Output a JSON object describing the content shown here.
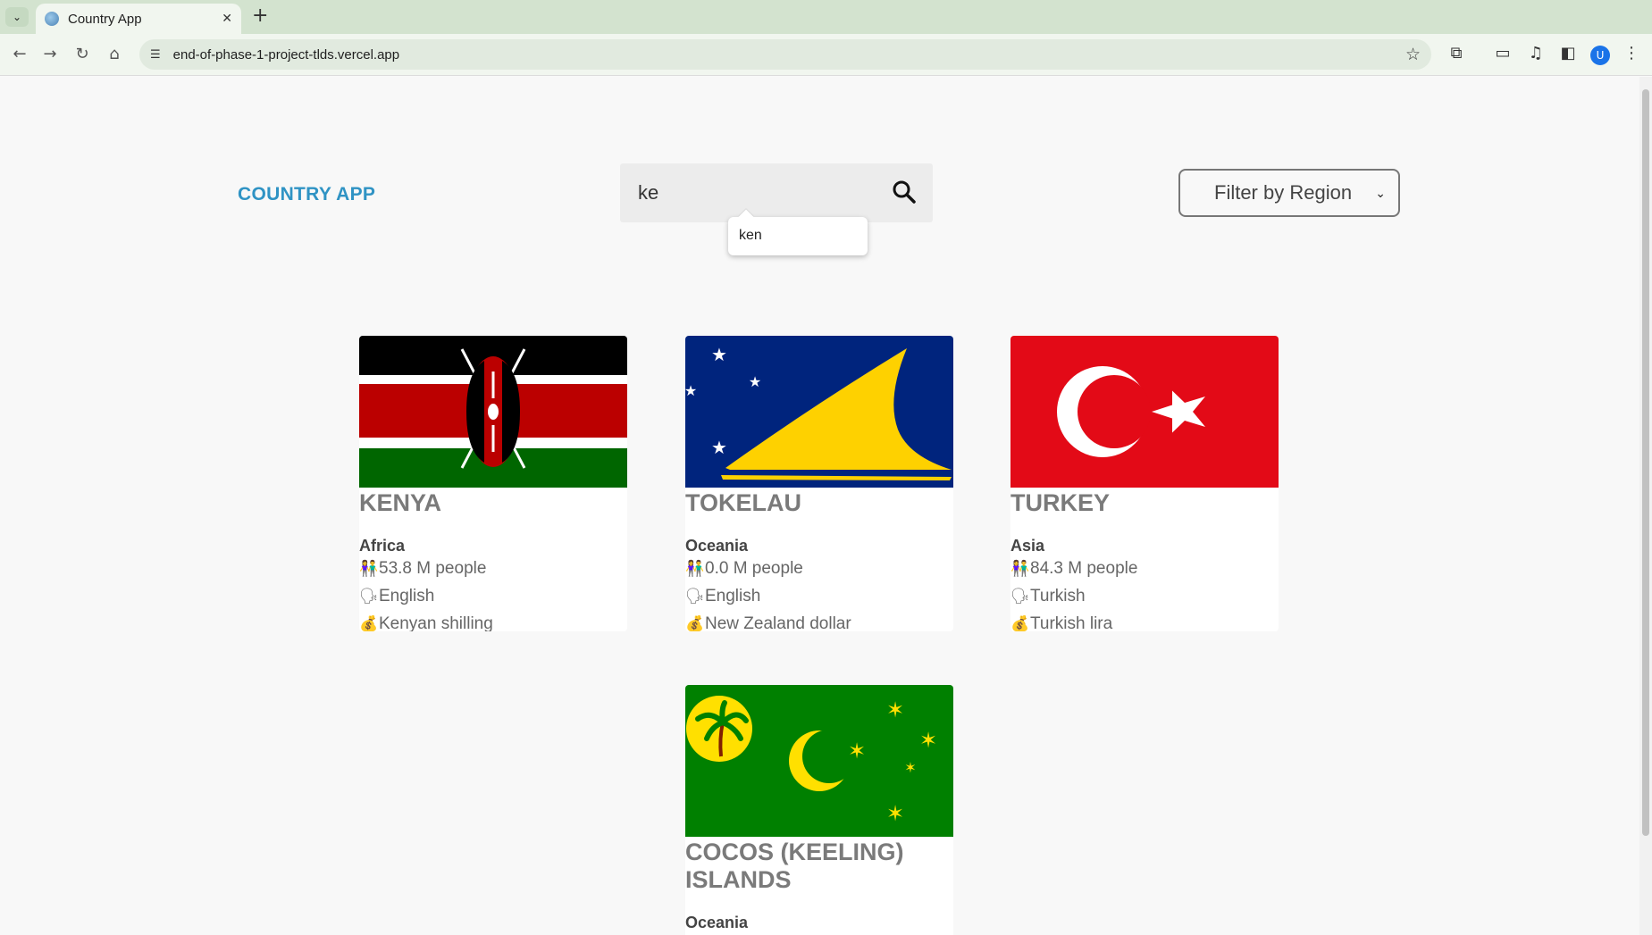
{
  "browser": {
    "tab_title": "Country App",
    "url": "end-of-phase-1-project-tlds.vercel.app",
    "profile_initial": "U"
  },
  "header": {
    "brand": "COUNTRY APP",
    "search_value": "ke",
    "autocomplete_suggestion": "ken",
    "region_filter": "Filter by Region"
  },
  "countries": [
    {
      "name": "KENYA",
      "region": "Africa",
      "population": "53.8 M people",
      "language": "English",
      "currency": "Kenyan shilling",
      "flag_icon": "kenya-flag"
    },
    {
      "name": "TOKELAU",
      "region": "Oceania",
      "population": "0.0 M people",
      "language": "English",
      "currency": "New Zealand dollar",
      "flag_icon": "tokelau-flag"
    },
    {
      "name": "TURKEY",
      "region": "Asia",
      "population": "84.3 M people",
      "language": "Turkish",
      "currency": "Turkish lira",
      "flag_icon": "turkey-flag"
    },
    {
      "name": "COCOS (KEELING) ISLANDS",
      "region": "Oceania",
      "flag_icon": "cocos-flag"
    }
  ],
  "colors": {
    "brand": "#2f93c4",
    "name_gray": "#7a7a7a"
  }
}
